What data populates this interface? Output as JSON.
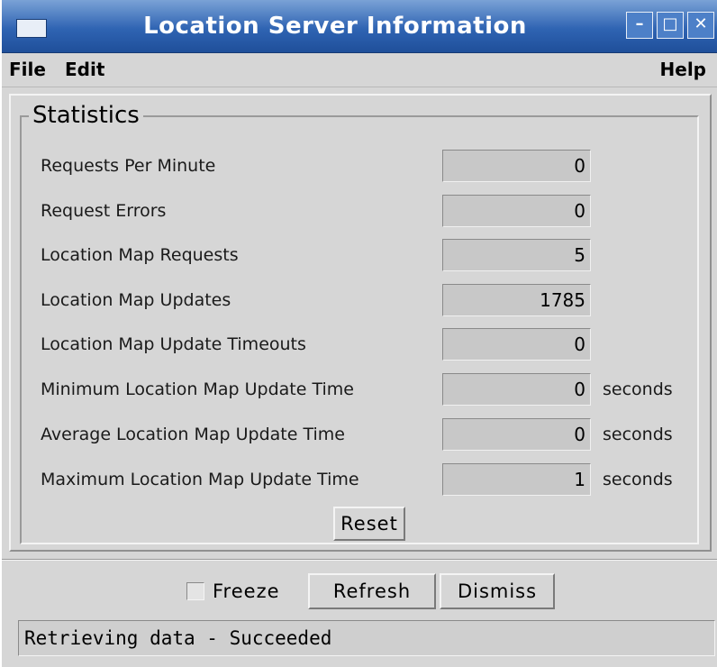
{
  "window": {
    "title": "Location Server Information"
  },
  "menu": {
    "file": "File",
    "edit": "Edit",
    "help": "Help"
  },
  "statistics": {
    "group_label": "Statistics",
    "rows": [
      {
        "label": "Requests Per Minute",
        "value": "0",
        "unit": ""
      },
      {
        "label": "Request Errors",
        "value": "0",
        "unit": ""
      },
      {
        "label": "Location Map Requests",
        "value": "5",
        "unit": ""
      },
      {
        "label": "Location Map Updates",
        "value": "1785",
        "unit": ""
      },
      {
        "label": "Location Map Update Timeouts",
        "value": "0",
        "unit": ""
      },
      {
        "label": "Minimum Location Map Update Time",
        "value": "0",
        "unit": "seconds"
      },
      {
        "label": "Average Location Map Update Time",
        "value": "0",
        "unit": "seconds"
      },
      {
        "label": "Maximum Location Map Update Time",
        "value": "1",
        "unit": "seconds"
      }
    ],
    "reset_label": "Reset"
  },
  "controls": {
    "freeze_label": "Freeze",
    "freeze_checked": false,
    "refresh_label": "Refresh",
    "dismiss_label": "Dismiss"
  },
  "status": {
    "text": "Retrieving data - Succeeded"
  }
}
